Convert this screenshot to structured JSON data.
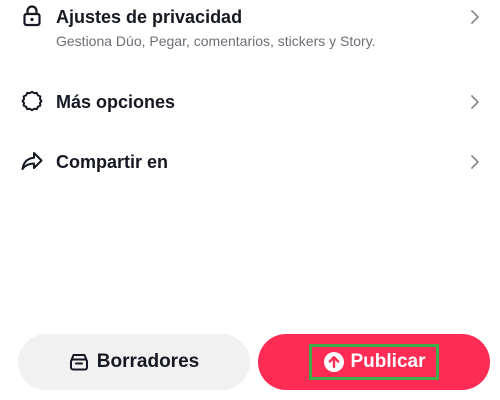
{
  "settings": {
    "privacy": {
      "title": "Ajustes de privacidad",
      "subtitle": "Gestiona Dúo, Pegar, comentarios, stickers y Story.",
      "icon": "lock-icon"
    },
    "more": {
      "title": "Más opciones",
      "icon": "gear-icon"
    },
    "share": {
      "title": "Compartir en",
      "icon": "share-arrow-icon"
    }
  },
  "actions": {
    "drafts_label": "Borradores",
    "drafts_icon": "drafts-box-icon",
    "publish_label": "Publicar",
    "publish_icon": "upload-arrow-icon"
  },
  "colors": {
    "publish_bg": "#fe2c55",
    "drafts_bg": "#f1f1f2",
    "highlight": "#3fae49",
    "text_primary": "#161823",
    "text_secondary": "#6c6f75"
  }
}
